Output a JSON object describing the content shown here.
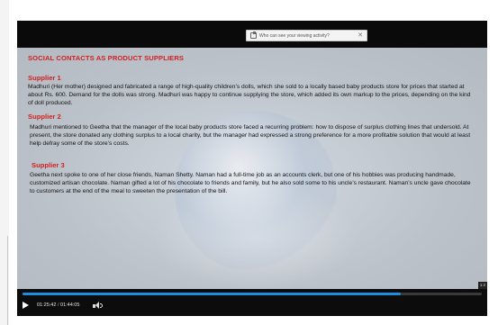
{
  "banner": {
    "text": "Who can see your viewing activity?",
    "close": "✕"
  },
  "slide": {
    "title": "SOCIAL CONTACTS AS PRODUCT SUPPLIERS",
    "suppliers": [
      {
        "heading": "Supplier 1",
        "text": "Madhuri (Her mother) designed and fabricated a range of high-quality children’s dolls, which she sold to a locally based baby products store for prices that started at about Rs. 600. Demand for the dolls was strong. Madhuri was happy to continue supplying the store, which added its own markup to the prices, depending on the kind of doll produced."
      },
      {
        "heading": "Supplier 2",
        "text": "Madhuri mentioned to Geetha that the manager of the local baby products store faced a recurring problem: how to dispose of surplus clothing lines that undersold. At present, the store donated any clothing surplus to a local charity, but the manager had expressed a strong preference for a more profitable solution that would at least help defray some of the store’s costs."
      },
      {
        "heading": "Supplier 3",
        "text": "Geetha next spoke to one of her close friends, Naman Shetty. Naman had a full-time job as an accounts clerk, but one of his hobbies was producing handmade, customized artisan chocolate. Naman gifted a lot of his chocolate to friends and family, but he also sold some to his uncle’s restaurant. Naman’s uncle gave chocolate to customers at the end of the meal to sweeten the presentation of the bill."
      }
    ]
  },
  "player": {
    "current_time": "01:25:42",
    "separator": "/",
    "total_time": "01:44:05",
    "progress": 0.823,
    "badge": "1:2",
    "accent_color": "#1e8fe0"
  },
  "icons": {
    "play": "play-icon",
    "volume": "volume-icon",
    "share": "share-icon",
    "close": "close-icon"
  }
}
